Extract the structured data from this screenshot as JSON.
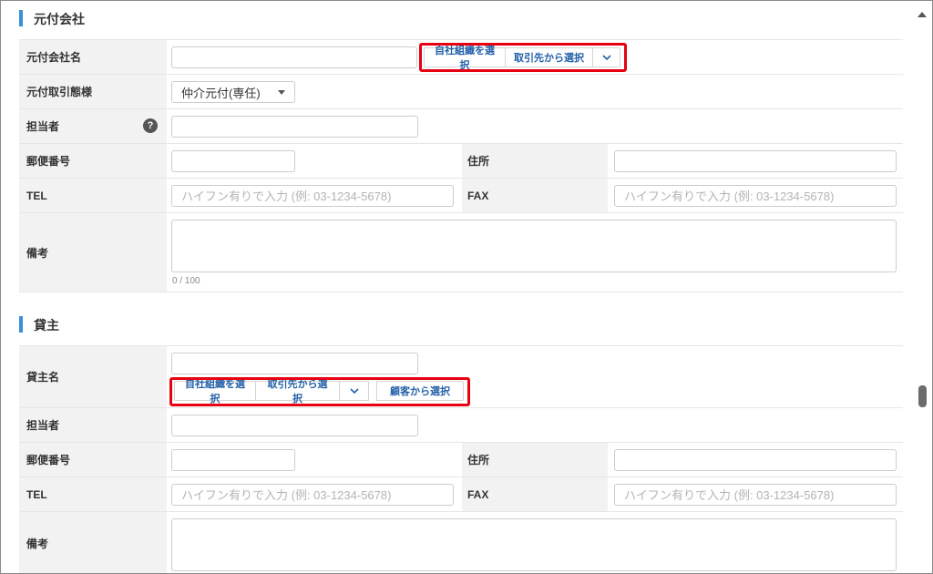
{
  "sections": {
    "motoduke": {
      "title": "元付会社",
      "company_name": {
        "label": "元付会社名",
        "value": "",
        "buttons": [
          "自社組織を選択",
          "取引先から選択"
        ]
      },
      "deal_type": {
        "label": "元付取引態様",
        "selected": "仲介元付(専任)"
      },
      "person": {
        "label": "担当者",
        "help_glyph": "?",
        "value": ""
      },
      "postal": {
        "label": "郵便番号",
        "value": ""
      },
      "address": {
        "label": "住所",
        "value": ""
      },
      "tel": {
        "label": "TEL",
        "placeholder": "ハイフン有りで入力 (例: 03-1234-5678)"
      },
      "fax": {
        "label": "FAX",
        "placeholder": "ハイフン有りで入力 (例: 03-1234-5678)"
      },
      "notes": {
        "label": "備考",
        "value": "",
        "counter": "0 / 100"
      }
    },
    "kashinushi": {
      "title": "貸主",
      "name": {
        "label": "貸主名",
        "value": "",
        "buttons": [
          "自社組織を選択",
          "取引先から選択"
        ],
        "extra_button": "顧客から選択"
      },
      "person": {
        "label": "担当者",
        "value": ""
      },
      "postal": {
        "label": "郵便番号",
        "value": ""
      },
      "address": {
        "label": "住所",
        "value": ""
      },
      "tel": {
        "label": "TEL",
        "placeholder": "ハイフン有りで入力 (例: 03-1234-5678)"
      },
      "fax": {
        "label": "FAX",
        "placeholder": "ハイフン有りで入力 (例: 03-1234-5678)"
      },
      "notes": {
        "label": "備考",
        "value": ""
      }
    }
  },
  "colors": {
    "section_accent": "#3a8fd9",
    "highlight_box": "#e60012",
    "button_text": "#2360a8",
    "label_bg": "#f2f2f2"
  },
  "icons": {
    "dropdown": "chevron-down-icon",
    "help": "help-circle-icon",
    "scroll_up": "scroll-up-arrow-icon"
  }
}
